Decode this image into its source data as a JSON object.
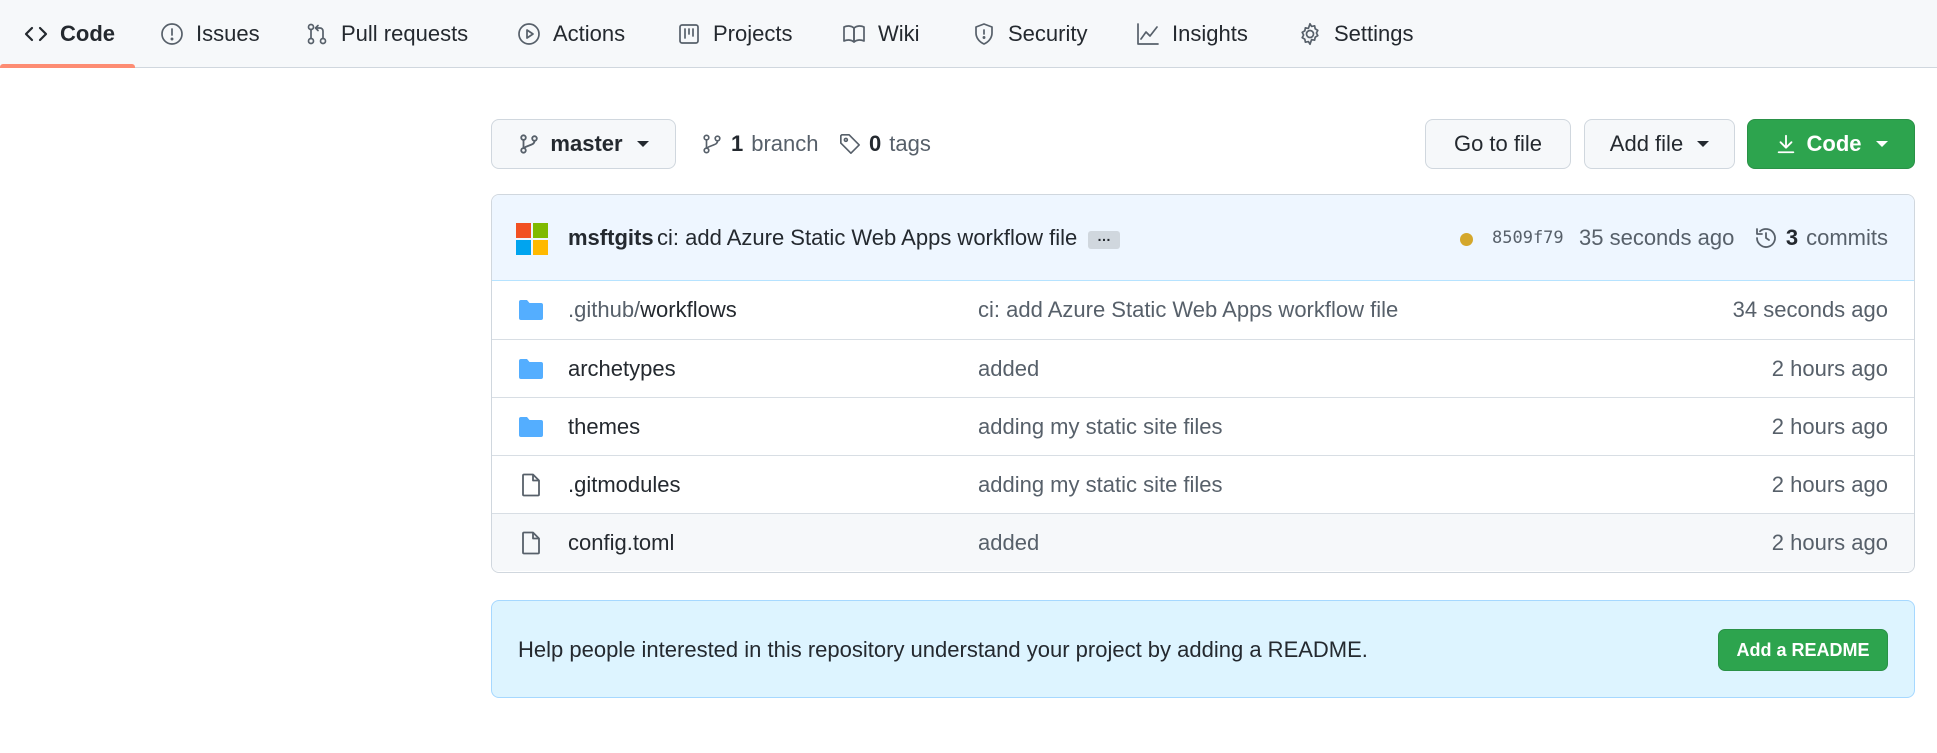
{
  "nav": {
    "tabs": [
      {
        "label": "Code",
        "icon": "code-icon"
      },
      {
        "label": "Issues",
        "icon": "issue-icon"
      },
      {
        "label": "Pull requests",
        "icon": "pull-request-icon"
      },
      {
        "label": "Actions",
        "icon": "play-icon"
      },
      {
        "label": "Projects",
        "icon": "project-icon"
      },
      {
        "label": "Wiki",
        "icon": "book-icon"
      },
      {
        "label": "Security",
        "icon": "shield-icon"
      },
      {
        "label": "Insights",
        "icon": "graph-icon"
      },
      {
        "label": "Settings",
        "icon": "gear-icon"
      }
    ],
    "active_tab": "Code",
    "active_color": "#fd8c73"
  },
  "toolbar": {
    "branch_label": "master",
    "branch_count": "1",
    "branch_word": "branch",
    "tag_count": "0",
    "tag_word": "tags",
    "go_to_file": "Go to file",
    "add_file": "Add file",
    "code_button": "Code"
  },
  "latest_commit": {
    "author": "msftgits",
    "message": "ci: add Azure Static Web Apps workflow file",
    "ellipsis": "…",
    "sha": "8509f79",
    "time": "35 seconds ago",
    "commits_count": "3",
    "commits_word": "commits",
    "status_color": "#d4a72c"
  },
  "files": [
    {
      "type": "folder",
      "prefix": ".github/",
      "name": "workflows",
      "message": "ci: add Azure Static Web Apps workflow file",
      "time": "34 seconds ago"
    },
    {
      "type": "folder",
      "prefix": "",
      "name": "archetypes",
      "message": "added",
      "time": "2 hours ago"
    },
    {
      "type": "folder",
      "prefix": "",
      "name": "themes",
      "message": "adding my static site files",
      "time": "2 hours ago"
    },
    {
      "type": "file",
      "prefix": "",
      "name": ".gitmodules",
      "message": "adding my static site files",
      "time": "2 hours ago"
    },
    {
      "type": "file",
      "prefix": "",
      "name": "config.toml",
      "message": "added",
      "time": "2 hours ago"
    }
  ],
  "readme": {
    "text": "Help people interested in this repository understand your project by adding a README.",
    "button": "Add a README"
  },
  "colors": {
    "green": "#2da44e",
    "folder": "#54aeff",
    "banner": "#ddf4ff"
  }
}
